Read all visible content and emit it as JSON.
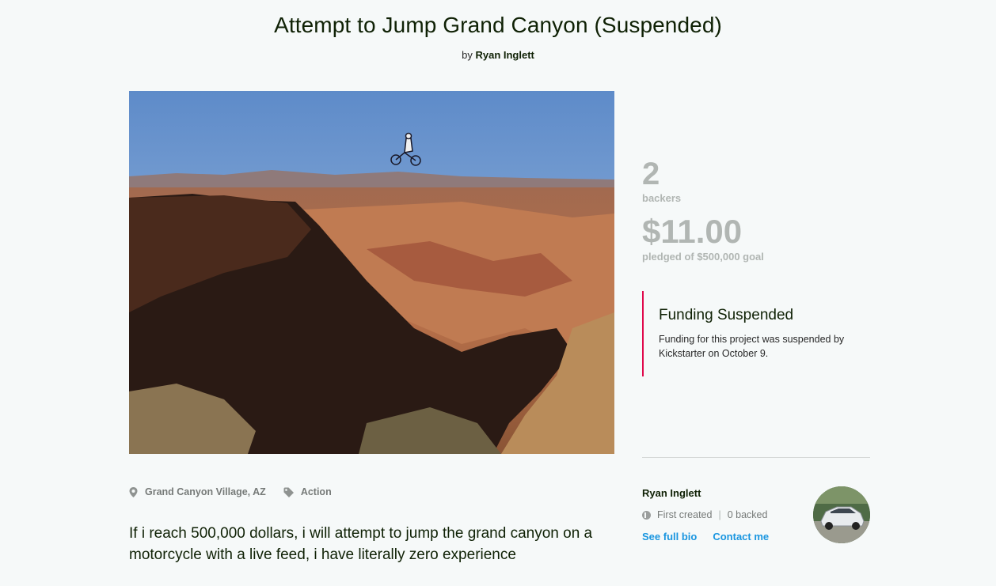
{
  "project": {
    "title": "Attempt to Jump Grand Canyon (Suspended)",
    "by_prefix": "by",
    "creator": "Ryan Inglett"
  },
  "stats": {
    "backers_count": "2",
    "backers_label": "backers",
    "pledged_amount": "$11.00",
    "pledged_label": "pledged of $500,000 goal"
  },
  "status": {
    "heading": "Funding Suspended",
    "message": "Funding for this project was suspended by Kickstarter on October 9.",
    "accent_color": "#e0084b"
  },
  "creator_card": {
    "name": "Ryan Inglett",
    "created_label": "First created",
    "separator": "|",
    "backed_label": "0 backed",
    "see_bio": "See full bio",
    "contact": "Contact me"
  },
  "meta": {
    "location": "Grand Canyon Village, AZ",
    "location_icon": "map-pin-icon",
    "category": "Action",
    "category_icon": "tag-icon"
  },
  "description": "If i reach 500,000 dollars, i will attempt to jump the grand canyon on a motorcycle with a live feed, i have literally zero experience",
  "colors": {
    "link": "#1a96e0",
    "heading": "#0f2105",
    "muted": "#b1b6b3"
  }
}
